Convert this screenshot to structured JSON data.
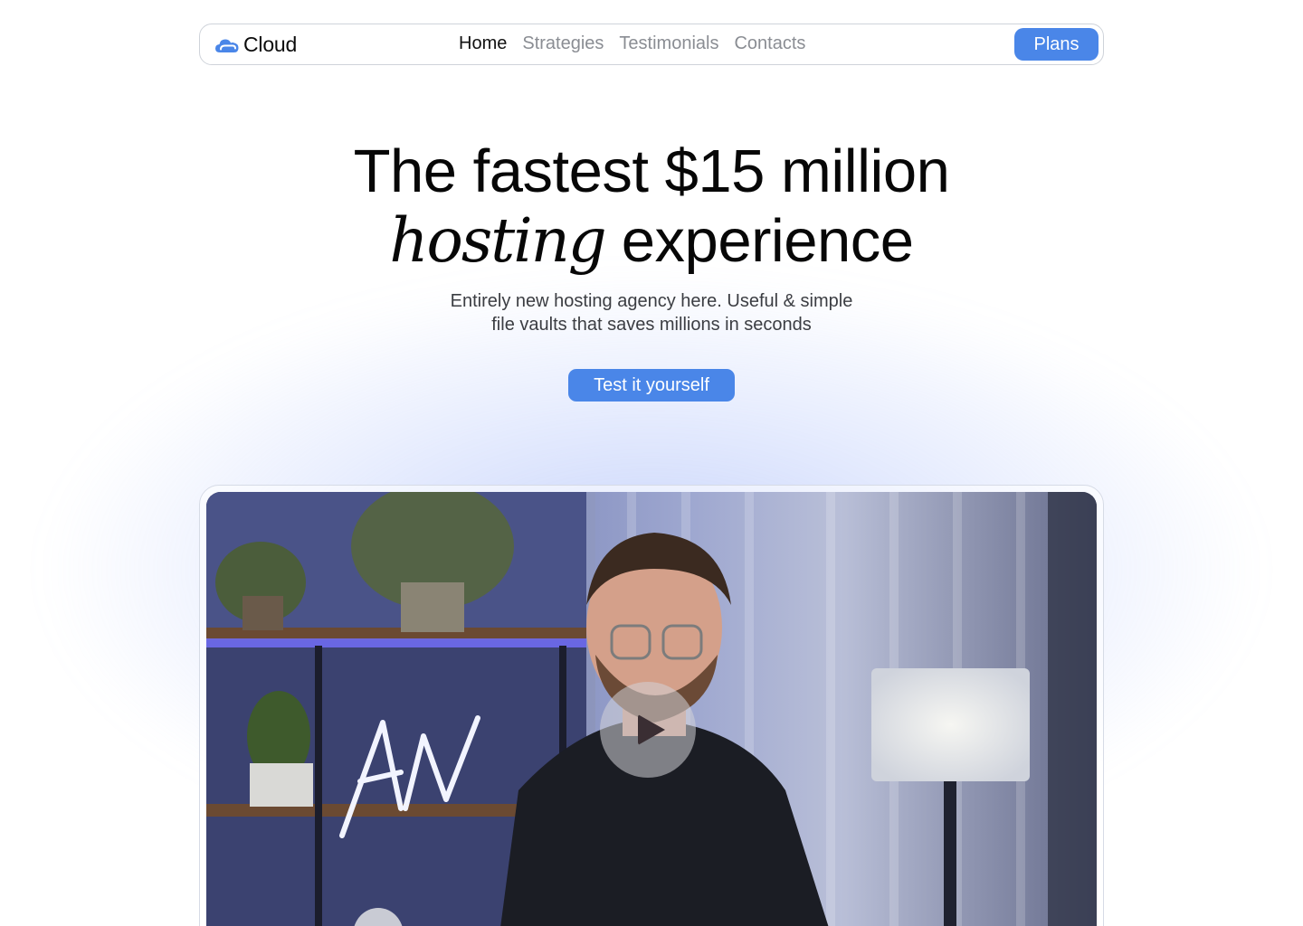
{
  "nav": {
    "brand": "Cloud",
    "links": [
      {
        "label": "Home",
        "active": true
      },
      {
        "label": "Strategies",
        "active": false
      },
      {
        "label": "Testimonials",
        "active": false
      },
      {
        "label": "Contacts",
        "active": false
      }
    ],
    "plans_label": "Plans"
  },
  "hero": {
    "title_line1": "The fastest $15 million",
    "title_italic": "hosting",
    "title_rest": "experience",
    "subtitle_line1": "Entirely new hosting agency here. Useful & simple",
    "subtitle_line2": "file vaults that saves millions in seconds",
    "cta_label": "Test it yourself"
  },
  "video": {
    "neon_sign": "AW",
    "play_icon": "play-icon"
  },
  "colors": {
    "accent": "#4a86e8",
    "text": "#0b0b0b",
    "muted": "#8a8d93"
  }
}
